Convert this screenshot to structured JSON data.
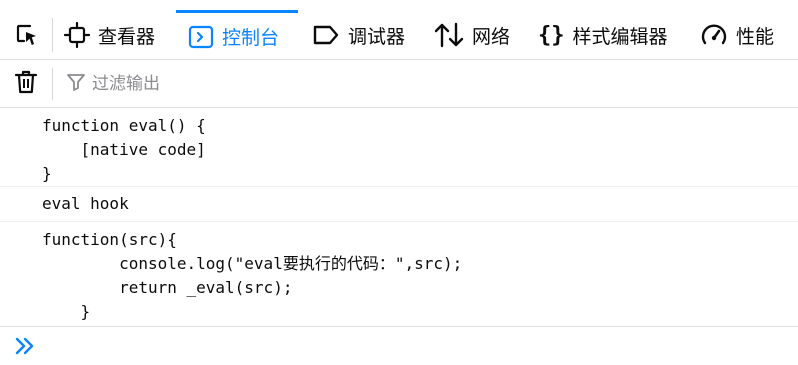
{
  "tabs": [
    {
      "label": "查看器",
      "icon": "inspector-icon"
    },
    {
      "label": "控制台",
      "icon": "console-icon",
      "active": true
    },
    {
      "label": "调试器",
      "icon": "debugger-icon"
    },
    {
      "label": "网络",
      "icon": "network-icon"
    },
    {
      "label": "样式编辑器",
      "icon": "style-editor-icon"
    },
    {
      "label": "性能",
      "icon": "performance-icon"
    }
  ],
  "toolbar": {
    "filter_placeholder": "过滤输出"
  },
  "console": {
    "messages": [
      {
        "text": "function eval() {\n    [native code]\n}"
      },
      {
        "text": "eval hook"
      },
      {
        "text": "function(src){\n        console.log(\"eval要执行的代码：\",src);\n        return _eval(src);\n    }"
      }
    ],
    "input_value": ""
  },
  "colors": {
    "accent": "#0a84ff",
    "border": "#e0e0e2",
    "text": "#0c0c0d",
    "placeholder": "#8c8c90"
  }
}
